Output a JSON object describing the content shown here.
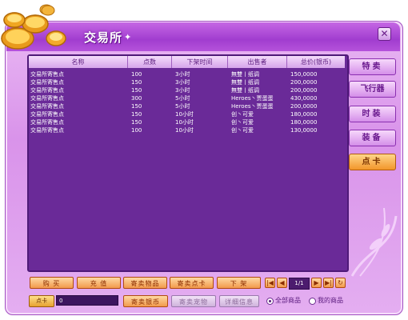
{
  "window": {
    "title": "交易所",
    "close_label": "✕"
  },
  "table": {
    "headers": [
      "名称",
      "点数",
      "下架时间",
      "出售者",
      "总价(银币)"
    ],
    "rows": [
      [
        "交易所寄售点",
        "100",
        "3小时",
        "無雙丨纸调",
        "150,0000"
      ],
      [
        "交易所寄售点",
        "150",
        "3小时",
        "無雙丨纸调",
        "200,0000"
      ],
      [
        "交易所寄售点",
        "150",
        "3小时",
        "無雙丨纸调",
        "200,0000"
      ],
      [
        "交易所寄售点",
        "300",
        "5小时",
        "Heroes丶贾蛋蛋",
        "430,0000"
      ],
      [
        "交易所寄售点",
        "150",
        "5小时",
        "Heroes丶贾蛋蛋",
        "200,0000"
      ],
      [
        "交易所寄售点",
        "150",
        "10小时",
        "创丶可爱",
        "180,0000"
      ],
      [
        "交易所寄售点",
        "150",
        "10小时",
        "创丶可爱",
        "180,0000"
      ],
      [
        "交易所寄售点",
        "100",
        "10小时",
        "创丶可爱",
        "130,0000"
      ]
    ]
  },
  "tabs": [
    {
      "label": "特卖",
      "active": false
    },
    {
      "label": "飞行器",
      "active": false
    },
    {
      "label": "时装",
      "active": false
    },
    {
      "label": "装备",
      "active": false
    },
    {
      "label": "点卡",
      "active": true
    }
  ],
  "buttons": {
    "buy": "购 买",
    "recharge": "充 值",
    "sell_item": "寄卖物品",
    "sell_card": "寄卖点卡",
    "delist": "下 架",
    "sell_silver": "寄卖银币",
    "sell_pet": "寄卖宠物",
    "details": "详细信息"
  },
  "pagination": {
    "first": "|◀",
    "prev": "◀",
    "page": "1/1",
    "next": "▶",
    "last": "▶|",
    "refresh": "↻"
  },
  "wallet": {
    "label": "点卡",
    "value": "0"
  },
  "filter": {
    "all": "全部商品",
    "mine": "我的商品",
    "selected": "all"
  },
  "colors": {
    "accent": "#a13dcf",
    "panel": "#6a2a98",
    "active_tab": "#f2962b"
  }
}
